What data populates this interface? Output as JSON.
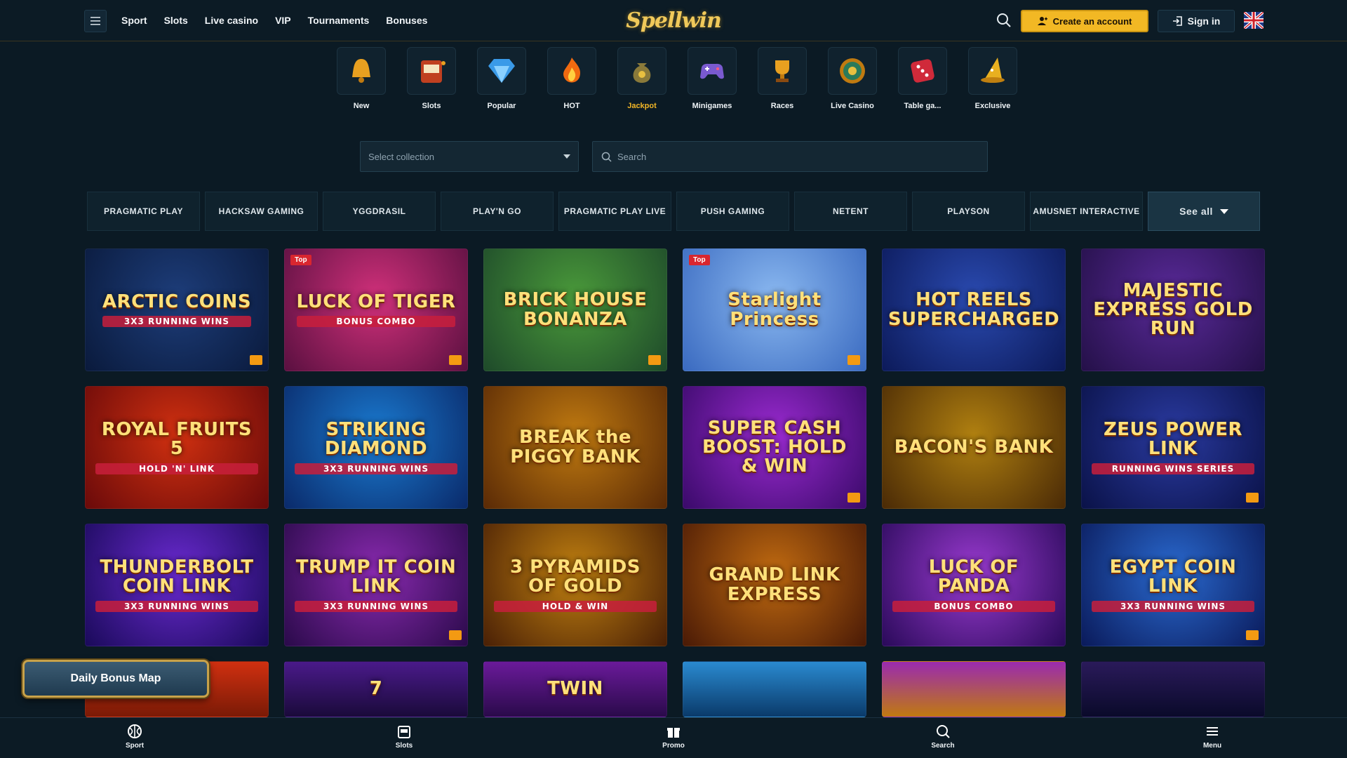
{
  "header": {
    "nav": [
      "Sport",
      "Slots",
      "Live casino",
      "VIP",
      "Tournaments",
      "Bonuses"
    ],
    "logo_text": "Spellwin",
    "create_account": "Create an account",
    "sign_in": "Sign in",
    "language_flag": "uk-flag-icon"
  },
  "categories": [
    {
      "label": "New",
      "icon": "bell-icon"
    },
    {
      "label": "Slots",
      "icon": "slot-machine-icon"
    },
    {
      "label": "Popular",
      "icon": "diamond-icon"
    },
    {
      "label": "HOT",
      "icon": "fire-icon"
    },
    {
      "label": "Jackpot",
      "icon": "money-bag-icon",
      "active": true
    },
    {
      "label": "Minigames",
      "icon": "gamepad-icon"
    },
    {
      "label": "Races",
      "icon": "trophy-icon"
    },
    {
      "label": "Live Casino",
      "icon": "roulette-icon"
    },
    {
      "label": "Table ga...",
      "icon": "dice-icon"
    },
    {
      "label": "Exclusive",
      "icon": "wizard-hat-icon"
    }
  ],
  "filters": {
    "collection_placeholder": "Select collection",
    "search_placeholder": "Search"
  },
  "providers": [
    "PRAGMATIC PLAY",
    "HACKSAW GAMING",
    "YGGDRASIL",
    "PLAY'N GO",
    "PRAGMATIC PLAY LIVE",
    "PUSH GAMING",
    "NETENT",
    "PLAYSON",
    "AMUSNET INTERACTIVE"
  ],
  "see_all": "See all",
  "games": [
    {
      "title": "ARCTIC COINS",
      "sub": "3X3 RUNNING WINS",
      "badge": "",
      "colors": [
        "#1d3d7a",
        "#0a1a3c"
      ],
      "trophy": true
    },
    {
      "title": "LUCK OF TIGER",
      "sub": "BONUS COMBO",
      "badge": "Top",
      "colors": [
        "#d0307a",
        "#5a1040"
      ],
      "trophy": true
    },
    {
      "title": "BRICK HOUSE BONANZA",
      "sub": "",
      "badge": "",
      "colors": [
        "#4a9a3a",
        "#1e4a2a"
      ],
      "trophy": true
    },
    {
      "title": "Starlight Princess",
      "sub": "",
      "badge": "Top",
      "colors": [
        "#8ab8f0",
        "#3a6ac0"
      ],
      "trophy": true
    },
    {
      "title": "HOT REELS SUPERCHARGED",
      "sub": "",
      "badge": "",
      "colors": [
        "#2a4ab0",
        "#0c1a5a"
      ],
      "trophy": false
    },
    {
      "title": "MAJESTIC EXPRESS GOLD RUN",
      "sub": "",
      "badge": "",
      "colors": [
        "#5a2a9a",
        "#241048"
      ],
      "trophy": false
    },
    {
      "title": "ROYAL FRUITS 5",
      "sub": "HOLD 'N' LINK",
      "badge": "",
      "colors": [
        "#d03010",
        "#6a0a0a"
      ],
      "trophy": false
    },
    {
      "title": "STRIKING DIAMOND",
      "sub": "3X3 RUNNING WINS",
      "badge": "",
      "colors": [
        "#1a7ad0",
        "#0a2a6a"
      ],
      "trophy": false
    },
    {
      "title": "BREAK the PIGGY BANK",
      "sub": "",
      "badge": "",
      "colors": [
        "#c07a10",
        "#5a2a06"
      ],
      "trophy": false
    },
    {
      "title": "SUPER CASH BOOST: HOLD & WIN",
      "sub": "",
      "badge": "",
      "colors": [
        "#9a2ad0",
        "#3a0a6a"
      ],
      "trophy": true
    },
    {
      "title": "BACON'S BANK",
      "sub": "",
      "badge": "",
      "colors": [
        "#b08010",
        "#4a2a06"
      ],
      "trophy": false
    },
    {
      "title": "ZEUS POWER LINK",
      "sub": "RUNNING WINS SERIES",
      "badge": "",
      "colors": [
        "#2a3aa0",
        "#0a1248"
      ],
      "trophy": true
    },
    {
      "title": "THUNDERBOLT COIN LINK",
      "sub": "3X3 RUNNING WINS",
      "badge": "",
      "colors": [
        "#6a2ad0",
        "#1a0a5a"
      ],
      "trophy": false
    },
    {
      "title": "TRUMP IT COIN LINK",
      "sub": "3X3 RUNNING WINS",
      "badge": "",
      "colors": [
        "#8a2ab0",
        "#2a0a4a"
      ],
      "trophy": true
    },
    {
      "title": "3 PYRAMIDS OF GOLD",
      "sub": "HOLD & WIN",
      "badge": "",
      "colors": [
        "#c08010",
        "#4a2006"
      ],
      "trophy": false
    },
    {
      "title": "GRAND LINK EXPRESS",
      "sub": "",
      "badge": "",
      "colors": [
        "#c06a10",
        "#4a1a06"
      ],
      "trophy": false
    },
    {
      "title": "LUCK OF PANDA",
      "sub": "BONUS COMBO",
      "badge": "",
      "colors": [
        "#9a3ad0",
        "#2a0a5a"
      ],
      "trophy": false
    },
    {
      "title": "EGYPT COIN LINK",
      "sub": "3X3 RUNNING WINS",
      "badge": "",
      "colors": [
        "#2a6ad0",
        "#0a1a5a"
      ],
      "trophy": true
    }
  ],
  "partial_row": [
    {
      "title": "",
      "colors": [
        "#d03010",
        "#7a1a06"
      ]
    },
    {
      "title": "7",
      "colors": [
        "#4a1a8a",
        "#1a0a3a"
      ]
    },
    {
      "title": "TWIN",
      "colors": [
        "#6a1a9a",
        "#2a0a4a"
      ]
    },
    {
      "title": "",
      "colors": [
        "#2a8ad0",
        "#0a3a6a"
      ]
    },
    {
      "title": "",
      "colors": [
        "#9a2ab0",
        "#c07a10"
      ]
    },
    {
      "title": "",
      "colors": [
        "#2a1a5a",
        "#0a0a2a"
      ]
    }
  ],
  "daily_bonus": "Daily Bonus Map",
  "bottom_nav": [
    {
      "label": "Sport",
      "icon": "sport-icon"
    },
    {
      "label": "Slots",
      "icon": "slot-machine-icon"
    },
    {
      "label": "Promo",
      "icon": "gift-icon"
    },
    {
      "label": "Search",
      "icon": "search-icon"
    },
    {
      "label": "Menu",
      "icon": "menu-icon"
    }
  ]
}
